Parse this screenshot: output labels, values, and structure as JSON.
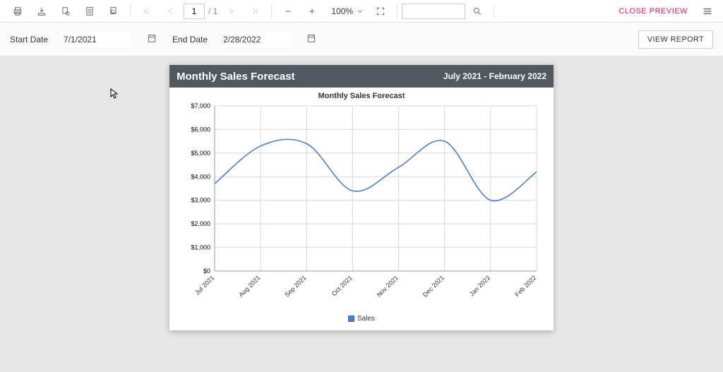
{
  "toolbar": {
    "page_current": "1",
    "page_total": "/ 1",
    "zoom_label": "100%",
    "close_preview": "CLOSE PREVIEW"
  },
  "params": {
    "start_label": "Start Date",
    "start_value": "7/1/2021",
    "end_label": "End Date",
    "end_value": "2/28/2022",
    "view_report": "VIEW REPORT"
  },
  "report": {
    "title": "Monthly Sales Forecast",
    "range": "July 2021 - February 2022",
    "chart_title": "Monthly Sales Forecast",
    "legend_label": "Sales"
  },
  "chart_data": {
    "type": "line",
    "title": "Monthly Sales Forecast",
    "xlabel": "",
    "ylabel": "",
    "ylim": [
      0,
      7000
    ],
    "y_ticks": [
      0,
      1000,
      2000,
      3000,
      4000,
      5000,
      6000,
      7000
    ],
    "y_tick_labels": [
      "$0",
      "$1,000",
      "$2,000",
      "$3,000",
      "$4,000",
      "$5,000",
      "$6,000",
      "$7,000"
    ],
    "categories": [
      "Jul 2021",
      "Aug 2021",
      "Sep 2021",
      "Oct 2021",
      "Nov 2021",
      "Dec 2021",
      "Jan 2022",
      "Feb 2022"
    ],
    "series": [
      {
        "name": "Sales",
        "values": [
          3700,
          5300,
          5400,
          3400,
          4400,
          5500,
          3000,
          4200
        ]
      }
    ],
    "legend_position": "bottom",
    "grid": true,
    "accent_color": "#4a7fc1"
  }
}
